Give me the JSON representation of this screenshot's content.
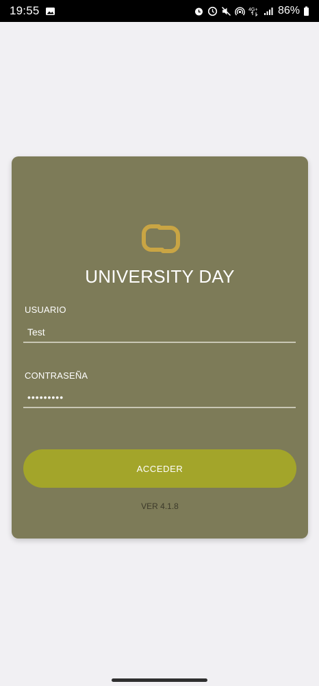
{
  "status_bar": {
    "time": "19:55",
    "battery": "86%",
    "icons": [
      "image-icon",
      "alarm-icon",
      "clock-icon",
      "mute-icon",
      "hotspot-icon",
      "4g-icon",
      "signal-icon",
      "battery-icon"
    ],
    "network_label": "4G+"
  },
  "login": {
    "title": "UNIVERSITY DAY",
    "username_label": "USUARIO",
    "username_value": "Test",
    "password_label": "CONTRASEÑA",
    "password_value": "•••••••••",
    "submit_label": "ACCEDER",
    "version": "VER 4.1.8"
  },
  "colors": {
    "card": "#7d7b58",
    "button": "#a3a52a",
    "logo": "#c9a544",
    "background": "#f1f0f3"
  }
}
